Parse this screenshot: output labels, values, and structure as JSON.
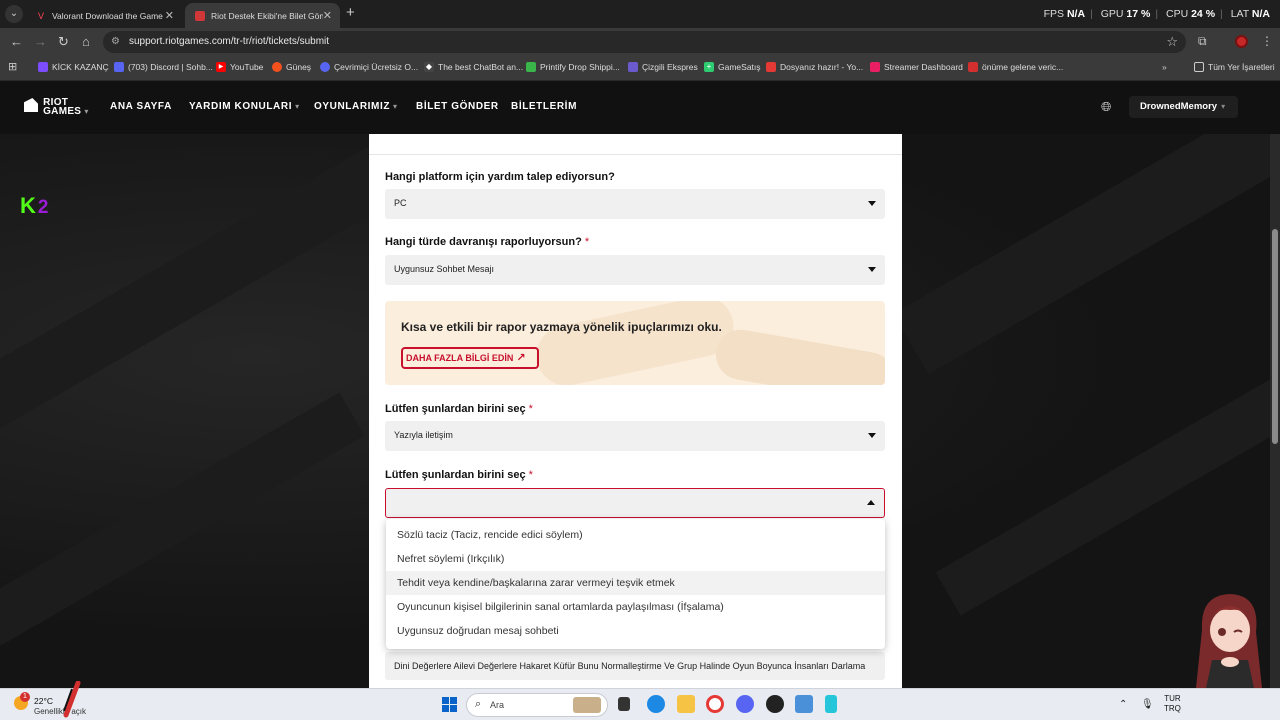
{
  "browser": {
    "tabs": [
      {
        "title": "Valorant Download the Game",
        "active": false
      },
      {
        "title": "Riot Destek Ekibi'ne Bilet Gönd",
        "active": true
      }
    ],
    "new_tab_icon": "plus-icon",
    "perf": {
      "fps_label": "FPS",
      "fps_value": "N/A",
      "gpu_label": "GPU",
      "gpu_value": "17 %",
      "cpu_label": "CPU",
      "cpu_value": "24 %",
      "lat_label": "LAT",
      "lat_value": "N/A"
    },
    "url": "support.riotgames.com/tr-tr/riot/tickets/submit",
    "bookmarks": [
      {
        "label": "KİCK KAZANÇ",
        "color": "#7b4dff"
      },
      {
        "label": "(703) Discord | Sohb...",
        "color": "#5865f2"
      },
      {
        "label": "YouTube",
        "color": "#ff0000"
      },
      {
        "label": "Güneş",
        "color": "#f4511e"
      },
      {
        "label": "Çevrimiçi Ücretsiz O...",
        "color": "#5865f2"
      },
      {
        "label": "The best ChatBot an...",
        "color": "#444444"
      },
      {
        "label": "Printify Drop Shippi...",
        "color": "#39b54a"
      },
      {
        "label": "Çizgili Ekspres",
        "color": "#6a5acd"
      },
      {
        "label": "GameSatış",
        "color": "#2ecc71"
      },
      {
        "label": "Dosyanız hazır! - Yo...",
        "color": "#e53935"
      },
      {
        "label": "Streamer Dashboard",
        "color": "#e91e63"
      },
      {
        "label": "önüme gelene veric...",
        "color": "#d32f2f"
      }
    ],
    "all_bookmarks_label": "Tüm Yer İşaretleri"
  },
  "site": {
    "logo_line1": "RIOT",
    "logo_line2": "GAMES",
    "nav": [
      {
        "label": "ANA SAYFA",
        "has_caret": false
      },
      {
        "label": "YARDIM KONULARI",
        "has_caret": true
      },
      {
        "label": "OYUNLARIMIZ",
        "has_caret": true
      },
      {
        "label": "BİLET GÖNDER",
        "has_caret": false
      },
      {
        "label": "BİLETLERİM",
        "has_caret": false
      }
    ],
    "username": "DrownedMemory"
  },
  "overlay": {
    "k_letter": "K",
    "k_number": "2"
  },
  "form": {
    "q_platform": "Hangi platform için yardım talep ediyorsun?",
    "platform_value": "PC",
    "q_behavior": "Hangi türde davranışı raporluyorsun?",
    "behavior_value": "Uygunsuz Sohbet Mesajı",
    "required_mark": "*",
    "tip_text": "Kısa ve etkili bir rapor yazmaya yönelik ipuçlarımızı oku.",
    "tip_button": "DAHA FAZLA BİLGİ EDİN",
    "q_select1": "Lütfen şunlardan birini seç",
    "select1_value": "Yazıyla iletişim",
    "q_select2": "Lütfen şunlardan birini seç",
    "select2_value": "",
    "dropdown_options": [
      "Sözlü taciz (Taciz, rencide edici söylem)",
      "Nefret söylemi (Irkçılık)",
      "Tehdit veya kendine/başkalarına zarar vermeyi teşvik etmek",
      "Oyuncunun kişisel bilgilerinin sanal ortamlarda paylaşılması (İfşalama)",
      "Uygunsuz doğrudan mesaj sohbeti"
    ],
    "hovered_option_index": 2,
    "description_value": "Dini Değerlere Ailevi Değerlere Hakaret Küfür Bunu Normalleştirme Ve Grup Halinde Oyun Boyunca İnsanları Darlama"
  },
  "taskbar": {
    "weather_badge": "1",
    "temperature": "22°C",
    "weather_desc": "Genellikle açık",
    "search_label": "Ara",
    "lang_top": "TUR",
    "lang_bottom": "TRQ"
  }
}
